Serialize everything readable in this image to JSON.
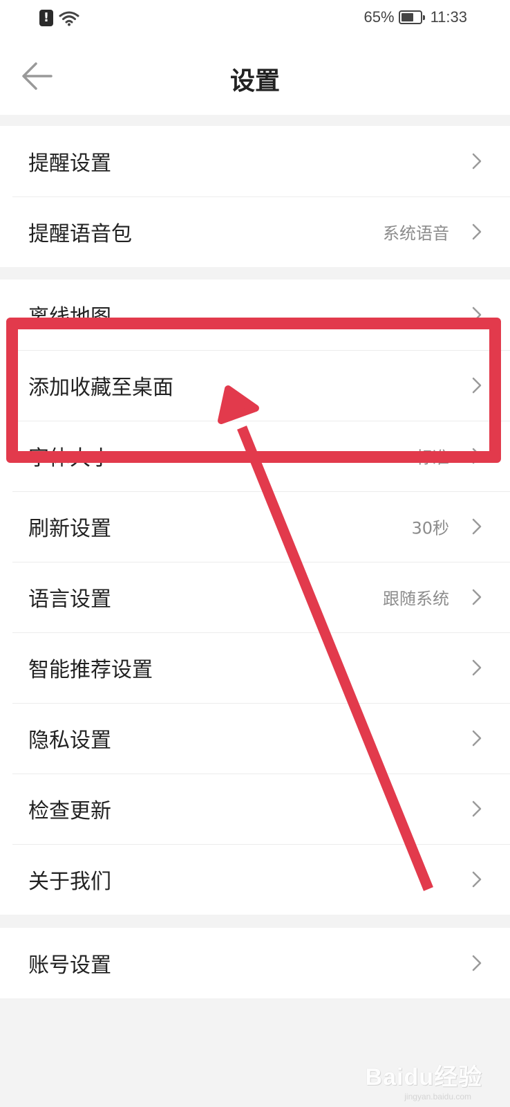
{
  "status_bar": {
    "battery_percent_label": "65%",
    "battery_level": 0.65,
    "time": "11:33",
    "alert_glyph": "!"
  },
  "header": {
    "title": "设置",
    "back_icon": "arrow-left-icon"
  },
  "groups": [
    {
      "items": [
        {
          "label": "提醒设置",
          "value": ""
        },
        {
          "label": "提醒语音包",
          "value": "系统语音"
        }
      ]
    },
    {
      "items": [
        {
          "label": "离线地图",
          "value": ""
        },
        {
          "label": "添加收藏至桌面",
          "value": ""
        },
        {
          "label": "字体大小",
          "value": "标准"
        },
        {
          "label": "刷新设置",
          "value": "30秒"
        },
        {
          "label": "语言设置",
          "value": "跟随系统"
        },
        {
          "label": "智能推荐设置",
          "value": ""
        },
        {
          "label": "隐私设置",
          "value": ""
        },
        {
          "label": "检查更新",
          "value": ""
        },
        {
          "label": "关于我们",
          "value": ""
        }
      ]
    },
    {
      "items": [
        {
          "label": "账号设置",
          "value": ""
        }
      ]
    }
  ],
  "annotation": {
    "highlighted_item": "添加收藏至桌面",
    "color": "#e23a4c"
  },
  "watermark": {
    "text": "Baidu经验",
    "sub": "jingyan.baidu.com"
  }
}
